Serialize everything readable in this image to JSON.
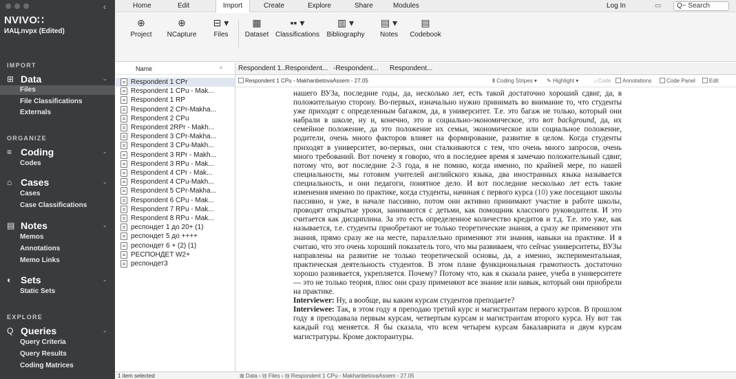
{
  "app": {
    "logo": "NVIVO∷",
    "project": "ИАЦ.nvpx (Edited)",
    "collapse_icon": "‹"
  },
  "ribbon_tabs": [
    {
      "label": "Home"
    },
    {
      "label": "Edit"
    },
    {
      "label": "Import"
    },
    {
      "label": "Create"
    },
    {
      "label": "Explore"
    },
    {
      "label": "Share"
    },
    {
      "label": "Modules"
    }
  ],
  "header_right": {
    "login": "Log In",
    "search_placeholder": "Q~ Search"
  },
  "ribbon_buttons": [
    {
      "label": "Project",
      "icon": "⊕"
    },
    {
      "label": "NCapture",
      "icon": "⊕"
    },
    {
      "label": "Files",
      "icon": "⊟ ▾"
    },
    {
      "label": "Dataset",
      "icon": "▦"
    },
    {
      "label": "Classifications",
      "icon": "▪▪ ▾"
    },
    {
      "label": "Bibliography",
      "icon": "▥ ▾"
    },
    {
      "label": "Notes",
      "icon": "▤ ▾"
    },
    {
      "label": "Codebook",
      "icon": "▤"
    }
  ],
  "sidebar": {
    "import_heading": "IMPORT",
    "data": {
      "label": "Data",
      "icon": "⊞",
      "items": [
        "Files",
        "File Classifications",
        "Externals"
      ]
    },
    "organize_heading": "ORGANIZE",
    "coding": {
      "label": "Coding",
      "icon": "≡",
      "items": [
        "Codes"
      ]
    },
    "cases": {
      "label": "Cases",
      "icon": "⌂",
      "items": [
        "Cases",
        "Case Classifications"
      ]
    },
    "notes": {
      "label": "Notes",
      "icon": "▤",
      "items": [
        "Memos",
        "Annotations",
        "Memo Links"
      ]
    },
    "sets": {
      "label": "Sets",
      "icon": "◐",
      "items": [
        "Static Sets"
      ]
    },
    "explore_heading": "EXPLORE",
    "queries": {
      "label": "Queries",
      "icon": "Q",
      "items": [
        "Query Criteria",
        "Query Results",
        "Coding Matrices"
      ]
    }
  },
  "file_list": {
    "column_header": "Name",
    "files": [
      "Respondent 1 CPr",
      "Respondent 1 CPu - Mak...",
      "Respondent 1 RP",
      "Respondent 2 CPr-Makha...",
      "Respondent 2 CPu",
      "Respondent 2RPr - Makh...",
      "Respondent 3 CPr-Makha...",
      "Respondent 3 CPu-Makh...",
      "Respondent 3 RPr - Makh...",
      "Respondent 3 RPu - Mak...",
      "Respondent 4 CPr - Mak...",
      "Respondent 4 CPu-Makh...",
      "Respondent 5 CPr-Makha...",
      "Respondent 6 CPu - Mak...",
      "Respondent 7 RPu - Mak...",
      "Respondent 8 RPu - Mak...",
      "респондет 1 до 20+ (1)",
      "респондет 5 до ++++",
      "респондет 6 + (2) (1)",
      "РЕСПОНДЕТ W2+",
      "респондет3"
    ],
    "status": "1 item selected"
  },
  "doc_tabs": [
    "Respondent 1...",
    "Respondent...",
    "-Respondent...",
    "Respondent..."
  ],
  "doc_toolbar": {
    "crumb": "Respondent 1 CPu - MakhanbetovaAssem - 27.05",
    "coding_stripes": "Coding Stripes ▾",
    "highlight": "Highlight ▾",
    "code": "Code",
    "annotations": "Annotations",
    "code_panel": "Code Panel",
    "edit": "Edit"
  },
  "document": {
    "p1": "нашего ВУЗа, последние годы, да, несколько лет, есть такой достаточно хороший сдвиг, да, в положительную сторону. Во-первых, изначально нужно принимать во внимание то, что студенты уже приходят с определенным багажом, да, в университет. Т.е. это багаж не только, который они набрали в школе, ну и, конечно, это и социально-экономическое, это вот ",
    "p1_em": "background",
    "p1b": ", да, их семейное положение, да это положение их семьи, экономическое или социальное положение, родители, очень много факторов влияет на формирование, развитие в целом. Когда студенты приходят в университет, во-первых, они сталкиваются с тем, что очень много запросов, очень много требований. Вот почему я говорю, что в последнее время я замечаю положительный сдвиг, потому что, вот последние 2-3 года, я не помню, когда именно, по крайней мере, по нашей специальности, мы готовим учителей английского языка, два иностранных языка называется специальность, и они педагоги, понятное дело. И вот последние несколько лет есть такие изменения именно по практике, когда студенты, начиная с первого курса ",
    "p1_cite": "(10)",
    "p1c": " уже посещают школы пассивно, и уже, в начале пассивно, потом они активно принимают участие в работе школы, проводят открытые уроки, занимаются с детьми, как помощник классного руководителя. И это считается как дисциплина. За это есть определенное количество кредитов и т.д. Т.е. это уже, как называется, т.е. студенты приобретают не только теоретические знания, а сразу же применяют эти знания, прямо сразу же на месте, параллельно применяют эти знания, навыки на практике. И я считаю, что это очень хороший показатель того, что мы развиваем, что сейчас университеты, ВУЗы направлены на развитие не только теоретической основы, да, а именно, экспериментальная, практическая деятельность студентов. В этом плане функциональная грамотность достаточно хорошо развивается, укрепляется. Почему? Потому что, как я сказала ранее, учеба в университете — это не только теория, плюс они сразу применяют все знание или навык, который они приобрели на практике.",
    "q_label": "Interviewer:",
    "q_text": " Ну, а вообще, вы каким курсам студентов преподаете?",
    "a_label": "Interviewee:",
    "a_text": " Так, в этом году я преподаю третий курс и магистрантам первого курсов. В прошлом году я преподавала первым курсам, четвертым курсам и магистрантам второго курса. Ну вот так каждый год меняется. Я бы сказала, что всем четырем курсам бакалавриата и двум курсам магистратуры. Кроме докторантуры."
  },
  "status_bar": "⊞ Data › ⊟ Files › ⊟ Respondent 1 CPu - MakhanbetovaAssem - 27.05"
}
